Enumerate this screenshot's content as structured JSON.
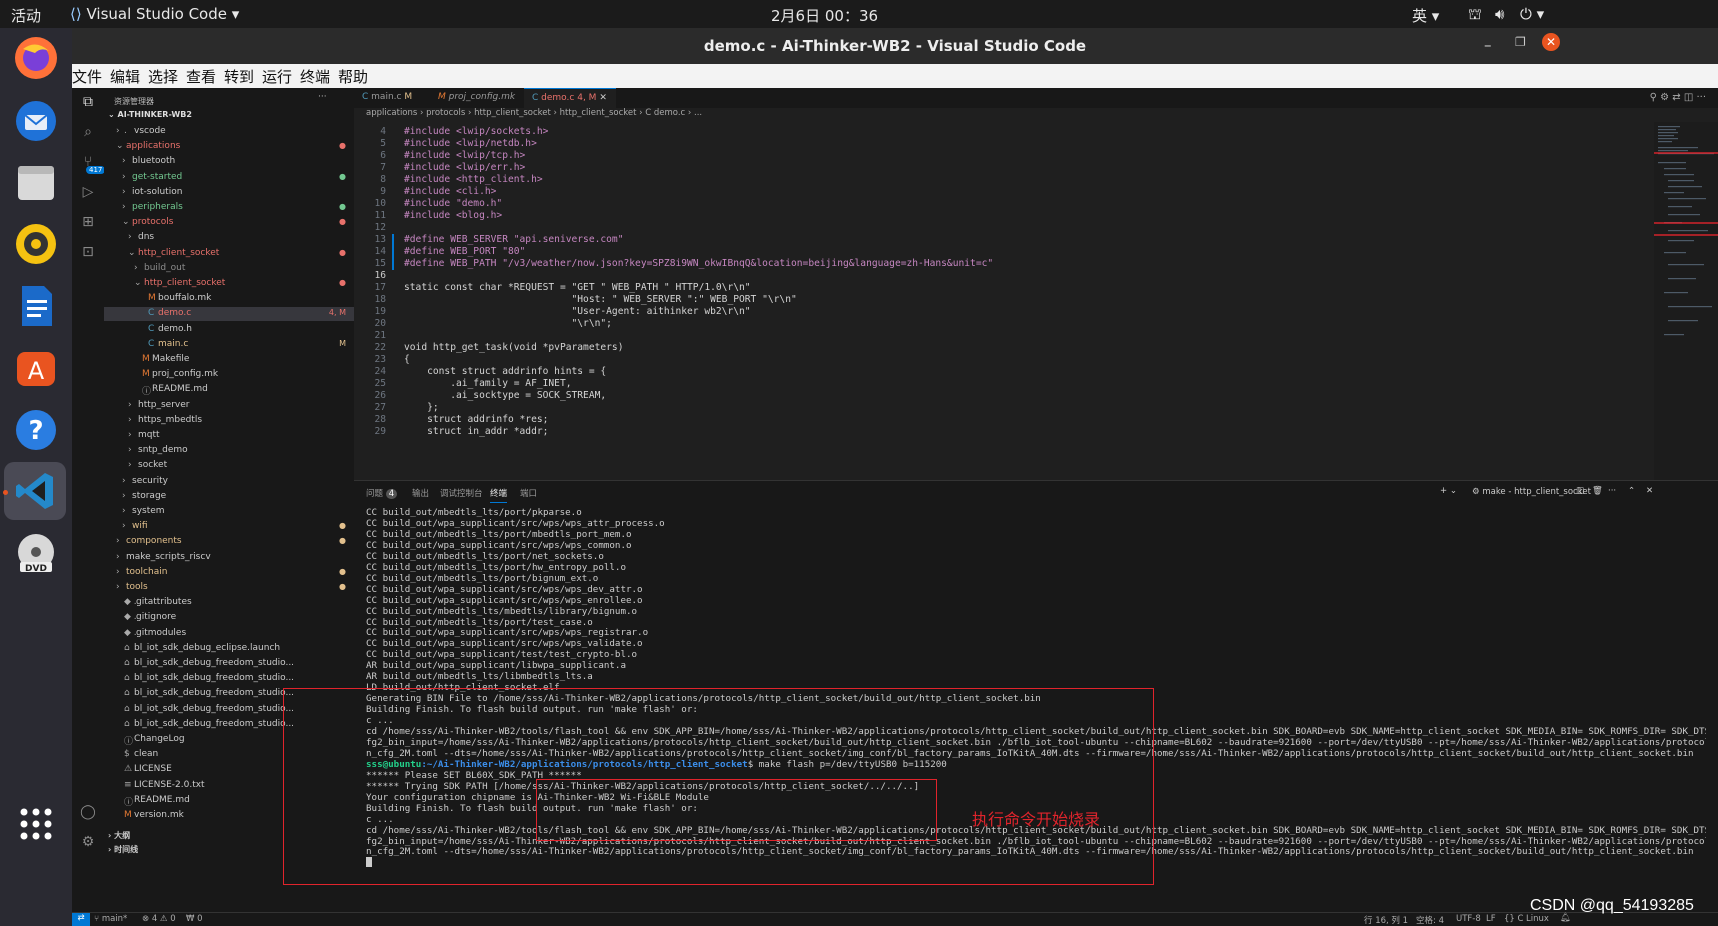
{
  "topbar": {
    "activities": "活动",
    "app_menu": "Visual Studio Code",
    "clock": "2月6日  00：36",
    "ime": "英"
  },
  "window": {
    "title": "demo.c - Ai-Thinker-WB2 - Visual Studio Code"
  },
  "menu": [
    "文件",
    "编辑",
    "选择",
    "查看",
    "转到",
    "运行",
    "终端",
    "帮助"
  ],
  "sidebar": {
    "header": "资源管理器",
    "root": "AI-THINKER-WB2",
    "items": [
      {
        "label": "vscode",
        "pre": ".",
        "tw": "›",
        "indent": 1,
        "color": "#ccc",
        "badge": ""
      },
      {
        "label": "applications",
        "pre": "",
        "tw": "⌄",
        "indent": 1,
        "color": "#e8716b",
        "badge": "●"
      },
      {
        "label": "bluetooth",
        "pre": "",
        "tw": "›",
        "indent": 2,
        "color": "#ccc",
        "badge": ""
      },
      {
        "label": "get-started",
        "pre": "",
        "tw": "›",
        "indent": 2,
        "color": "#73c991",
        "badge": "●"
      },
      {
        "label": "iot-solution",
        "pre": "",
        "tw": "›",
        "indent": 2,
        "color": "#ccc",
        "badge": ""
      },
      {
        "label": "peripherals",
        "pre": "",
        "tw": "›",
        "indent": 2,
        "color": "#73c991",
        "badge": "●"
      },
      {
        "label": "protocols",
        "pre": "",
        "tw": "⌄",
        "indent": 2,
        "color": "#e8716b",
        "badge": "●"
      },
      {
        "label": "dns",
        "pre": "",
        "tw": "›",
        "indent": 3,
        "color": "#ccc",
        "badge": ""
      },
      {
        "label": "http_client_socket",
        "pre": "",
        "tw": "⌄",
        "indent": 3,
        "color": "#e8716b",
        "badge": "●"
      },
      {
        "label": "build_out",
        "pre": "",
        "tw": "›",
        "indent": 4,
        "color": "#8c8c8c",
        "badge": ""
      },
      {
        "label": "http_client_socket",
        "pre": "",
        "tw": "⌄",
        "indent": 4,
        "color": "#e8716b",
        "badge": "●"
      },
      {
        "label": "bouffalo.mk",
        "pre": "M",
        "tw": "",
        "indent": 5,
        "color": "#ccc",
        "badge": ""
      },
      {
        "label": "demo.c",
        "pre": "C",
        "tw": "",
        "indent": 5,
        "color": "#e8716b",
        "badge": "4, M",
        "selected": true
      },
      {
        "label": "demo.h",
        "pre": "C",
        "tw": "",
        "indent": 5,
        "color": "#ccc",
        "badge": ""
      },
      {
        "label": "main.c",
        "pre": "C",
        "tw": "",
        "indent": 5,
        "color": "#e2c08d",
        "badge": "M"
      },
      {
        "label": "Makefile",
        "pre": "M",
        "tw": "",
        "indent": 4,
        "color": "#ccc",
        "badge": ""
      },
      {
        "label": "proj_config.mk",
        "pre": "M",
        "tw": "",
        "indent": 4,
        "color": "#ccc",
        "badge": ""
      },
      {
        "label": "README.md",
        "pre": "ⓘ",
        "tw": "",
        "indent": 4,
        "color": "#ccc",
        "badge": ""
      },
      {
        "label": "http_server",
        "pre": "",
        "tw": "›",
        "indent": 3,
        "color": "#ccc",
        "badge": ""
      },
      {
        "label": "https_mbedtls",
        "pre": "",
        "tw": "›",
        "indent": 3,
        "color": "#ccc",
        "badge": ""
      },
      {
        "label": "mqtt",
        "pre": "",
        "tw": "›",
        "indent": 3,
        "color": "#ccc",
        "badge": ""
      },
      {
        "label": "sntp_demo",
        "pre": "",
        "tw": "›",
        "indent": 3,
        "color": "#ccc",
        "badge": ""
      },
      {
        "label": "socket",
        "pre": "",
        "tw": "›",
        "indent": 3,
        "color": "#ccc",
        "badge": ""
      },
      {
        "label": "security",
        "pre": "",
        "tw": "›",
        "indent": 2,
        "color": "#ccc",
        "badge": ""
      },
      {
        "label": "storage",
        "pre": "",
        "tw": "›",
        "indent": 2,
        "color": "#ccc",
        "badge": ""
      },
      {
        "label": "system",
        "pre": "",
        "tw": "›",
        "indent": 2,
        "color": "#ccc",
        "badge": ""
      },
      {
        "label": "wifi",
        "pre": "",
        "tw": "›",
        "indent": 2,
        "color": "#e2c08d",
        "badge": "●"
      },
      {
        "label": "components",
        "pre": "",
        "tw": "›",
        "indent": 1,
        "color": "#e2c08d",
        "badge": "●"
      },
      {
        "label": "make_scripts_riscv",
        "pre": "",
        "tw": "›",
        "indent": 1,
        "color": "#ccc",
        "badge": ""
      },
      {
        "label": "toolchain",
        "pre": "",
        "tw": "›",
        "indent": 1,
        "color": "#e2c08d",
        "badge": "●"
      },
      {
        "label": "tools",
        "pre": "",
        "tw": "›",
        "indent": 1,
        "color": "#e2c08d",
        "badge": "●"
      },
      {
        "label": "gitattributes",
        "pre": "◆ .",
        "tw": "",
        "indent": 1,
        "color": "#ccc",
        "badge": ""
      },
      {
        "label": "gitignore",
        "pre": "◆ .",
        "tw": "",
        "indent": 1,
        "color": "#ccc",
        "badge": ""
      },
      {
        "label": "gitmodules",
        "pre": "◆ .",
        "tw": "",
        "indent": 1,
        "color": "#ccc",
        "badge": ""
      },
      {
        "label": "bl_iot_sdk_debug_eclipse.launch",
        "pre": "⌂",
        "tw": "",
        "indent": 1,
        "color": "#ccc",
        "badge": ""
      },
      {
        "label": "bl_iot_sdk_debug_freedom_studio...",
        "pre": "⌂",
        "tw": "",
        "indent": 1,
        "color": "#ccc",
        "badge": ""
      },
      {
        "label": "bl_iot_sdk_debug_freedom_studio...",
        "pre": "⌂",
        "tw": "",
        "indent": 1,
        "color": "#ccc",
        "badge": ""
      },
      {
        "label": "bl_iot_sdk_debug_freedom_studio...",
        "pre": "⌂",
        "tw": "",
        "indent": 1,
        "color": "#ccc",
        "badge": ""
      },
      {
        "label": "bl_iot_sdk_debug_freedom_studio...",
        "pre": "⌂",
        "tw": "",
        "indent": 1,
        "color": "#ccc",
        "badge": ""
      },
      {
        "label": "bl_iot_sdk_debug_freedom_studio...",
        "pre": "⌂",
        "tw": "",
        "indent": 1,
        "color": "#ccc",
        "badge": ""
      },
      {
        "label": "ChangeLog",
        "pre": "ⓘ",
        "tw": "",
        "indent": 1,
        "color": "#ccc",
        "badge": ""
      },
      {
        "label": "clean",
        "pre": "$",
        "tw": "",
        "indent": 1,
        "color": "#ccc",
        "badge": ""
      },
      {
        "label": "LICENSE",
        "pre": "⚠",
        "tw": "",
        "indent": 1,
        "color": "#ccc",
        "badge": ""
      },
      {
        "label": "LICENSE-2.0.txt",
        "pre": "≡",
        "tw": "",
        "indent": 1,
        "color": "#ccc",
        "badge": ""
      },
      {
        "label": "README.md",
        "pre": "ⓘ",
        "tw": "",
        "indent": 1,
        "color": "#ccc",
        "badge": ""
      },
      {
        "label": "version.mk",
        "pre": "M",
        "tw": "",
        "indent": 1,
        "color": "#ccc",
        "badge": ""
      }
    ],
    "outline": "大纲",
    "timeline": "时间线"
  },
  "tabs": [
    {
      "label": "main.c",
      "mod": "M",
      "active": false
    },
    {
      "label": "proj_config.mk",
      "mod": "",
      "active": false
    },
    {
      "label": "demo.c",
      "mod": "4, M",
      "active": true
    }
  ],
  "breadcrumb": [
    "applications",
    "protocols",
    "http_client_socket",
    "http_client_socket",
    "C demo.c",
    "..."
  ],
  "code": [
    {
      "n": "4",
      "t": "#include <lwip/sockets.h>"
    },
    {
      "n": "5",
      "t": "#include <lwip/netdb.h>"
    },
    {
      "n": "6",
      "t": "#include <lwip/tcp.h>"
    },
    {
      "n": "7",
      "t": "#include <lwip/err.h>"
    },
    {
      "n": "8",
      "t": "#include <http_client.h>"
    },
    {
      "n": "9",
      "t": "#include <cli.h>"
    },
    {
      "n": "10",
      "t": "#include \"demo.h\""
    },
    {
      "n": "11",
      "t": "#include <blog.h>"
    },
    {
      "n": "12",
      "t": ""
    },
    {
      "n": "13",
      "t": "#define WEB_SERVER \"api.seniverse.com\""
    },
    {
      "n": "14",
      "t": "#define WEB_PORT \"80\""
    },
    {
      "n": "15",
      "t": "#define WEB_PATH \"/v3/weather/now.json?key=SPZ8i9WN_okwIBnqQ&location=beijing&language=zh-Hans&unit=c\""
    },
    {
      "n": "16",
      "t": ""
    },
    {
      "n": "17",
      "t": "static const char *REQUEST = \"GET \" WEB_PATH \" HTTP/1.0\\r\\n\""
    },
    {
      "n": "18",
      "t": "                             \"Host: \" WEB_SERVER \":\" WEB_PORT \"\\r\\n\""
    },
    {
      "n": "19",
      "t": "                             \"User-Agent: aithinker wb2\\r\\n\""
    },
    {
      "n": "20",
      "t": "                             \"\\r\\n\";"
    },
    {
      "n": "21",
      "t": ""
    },
    {
      "n": "22",
      "t": "void http_get_task(void *pvParameters)"
    },
    {
      "n": "23",
      "t": "{"
    },
    {
      "n": "24",
      "t": "    const struct addrinfo hints = {"
    },
    {
      "n": "25",
      "t": "        .ai_family = AF_INET,"
    },
    {
      "n": "26",
      "t": "        .ai_socktype = SOCK_STREAM,"
    },
    {
      "n": "27",
      "t": "    };"
    },
    {
      "n": "28",
      "t": "    struct addrinfo *res;"
    },
    {
      "n": "29",
      "t": "    struct in_addr *addr;"
    }
  ],
  "panel": {
    "tabs": [
      "问题",
      "输出",
      "调试控制台",
      "终端",
      "端口"
    ],
    "problems_count": "4",
    "active_tab": "终端",
    "terminal_name": "make - http_client_socket"
  },
  "terminal": [
    "CC build_out/mbedtls_lts/port/pkparse.o",
    "CC build_out/wpa_supplicant/src/wps/wps_attr_process.o",
    "CC build_out/mbedtls_lts/port/mbedtls_port_mem.o",
    "CC build_out/wpa_supplicant/src/wps/wps_common.o",
    "CC build_out/mbedtls_lts/port/net_sockets.o",
    "CC build_out/mbedtls_lts/port/hw_entropy_poll.o",
    "CC build_out/mbedtls_lts/port/bignum_ext.o",
    "CC build_out/wpa_supplicant/src/wps/wps_dev_attr.o",
    "CC build_out/wpa_supplicant/src/wps/wps_enrollee.o",
    "CC build_out/mbedtls_lts/mbedtls/library/bignum.o",
    "CC build_out/mbedtls_lts/port/test_case.o",
    "CC build_out/wpa_supplicant/src/wps/wps_registrar.o",
    "CC build_out/wpa_supplicant/src/wps/wps_validate.o",
    "CC build_out/wpa_supplicant/test/test_crypto-bl.o",
    "AR build_out/wpa_supplicant/libwpa_supplicant.a",
    "AR build_out/mbedtls_lts/libmbedtls_lts.a",
    "LD build_out/http_client_socket.elf",
    "Generating BIN File to /home/sss/Ai-Thinker-WB2/applications/protocols/http_client_socket/build_out/http_client_socket.bin",
    "Building Finish. To flash build output. run 'make flash' or:",
    "c ...",
    "cd /home/sss/Ai-Thinker-WB2/tools/flash_tool && env SDK_APP_BIN=/home/sss/Ai-Thinker-WB2/applications/protocols/http_client_socket/build_out/http_client_socket.bin SDK_BOARD=evb SDK_NAME=http_client_socket SDK_MEDIA_BIN= SDK_ROMFS_DIR= SDK_DTS= SDK_XTAL= BL_FLASH_TOOL_INPUT_PATH_c",
    "fg2_bin_input=/home/sss/Ai-Thinker-WB2/applications/protocols/http_client_socket/build_out/http_client_socket.bin ./bflb_iot_tool-ubuntu --chipname=BL602 --baudrate=921600 --port=/dev/ttyUSB0 --pt=/home/sss/Ai-Thinker-WB2/applications/protocols/http_client_socket/img_conf/partitio",
    "n_cfg_2M.toml --dts=/home/sss/Ai-Thinker-WB2/applications/protocols/http_client_socket/img_conf/bl_factory_params_IoTKitA_40M.dts --firmware=/home/sss/Ai-Thinker-WB2/applications/protocols/http_client_socket/build_out/http_client_socket.bin",
    "",
    "****** Please SET BL60X_SDK_PATH ******",
    "****** Trying SDK PATH [/home/sss/Ai-Thinker-WB2/applications/protocols/http_client_socket/../../..]",
    "Your configuration chipname is Ai-Thinker-WB2 Wi-Fi&BLE Module",
    "Building Finish. To flash build output. run 'make flash' or:",
    "c ...",
    "cd /home/sss/Ai-Thinker-WB2/tools/flash_tool && env SDK_APP_BIN=/home/sss/Ai-Thinker-WB2/applications/protocols/http_client_socket/build_out/http_client_socket.bin SDK_BOARD=evb SDK_NAME=http_client_socket SDK_MEDIA_BIN= SDK_ROMFS_DIR= SDK_DTS= SDK_XTAL= BL_FLASH_TOOL_INPUT_PATH_c",
    "fg2_bin_input=/home/sss/Ai-Thinker-WB2/applications/protocols/http_client_socket/build_out/http_client_socket.bin ./bflb_iot_tool-ubuntu --chipname=BL602 --baudrate=921600 --port=/dev/ttyUSB0 --pt=/home/sss/Ai-Thinker-WB2/applications/protocols/http_client_socket/img_conf/partitio",
    "n_cfg_2M.toml --dts=/home/sss/Ai-Thinker-WB2/applications/protocols/http_client_socket/img_conf/bl_factory_params_IoTKitA_40M.dts --firmware=/home/sss/Ai-Thinker-WB2/applications/protocols/http_client_socket/build_out/http_client_socket.bin"
  ],
  "prompt": {
    "user": "sss@ubuntu",
    "path": ":~/Ai-Thinker-WB2/applications/protocols/http_client_socket",
    "cmd": "$ make flash p=/dev/ttyUSB0 b=115200"
  },
  "annotation": "执行命令开始烧录",
  "status": {
    "branch": "main*",
    "errors": "⊗ 4 ⚠ 0",
    "ports": "₩ 0",
    "position": "行 16, 列 1",
    "spaces": "空格: 4",
    "encoding": "UTF-8",
    "eol": "LF",
    "lang": "{} C",
    "platform": "Linux"
  },
  "watermark": "CSDN @qq_54193285",
  "colors": {
    "accent": "#0078d4",
    "annotation": "#e0242c"
  }
}
